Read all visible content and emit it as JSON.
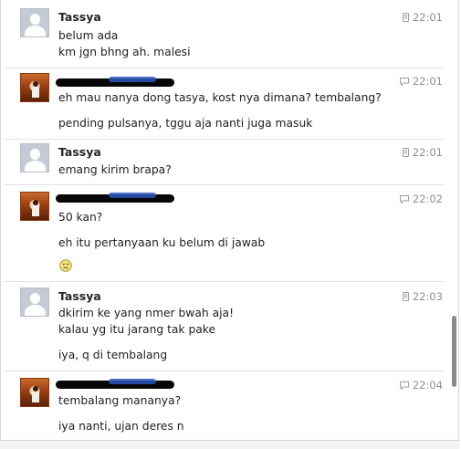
{
  "conversation": {
    "entries": [
      {
        "sender": "Tassya",
        "avatar": "default-avatar",
        "time": "22:01",
        "time_icon": "mobile-icon",
        "lines": [
          "belum ada",
          "km jgn bhng ah. malesi"
        ]
      },
      {
        "sender": "",
        "sender_redacted": true,
        "avatar": "photo-avatar",
        "time": "22:01",
        "time_icon": "chat-bubble-icon",
        "lines": [
          "eh mau nanya dong tasya, kost nya dimana? tembalang?",
          "pending pulsanya, tggu aja nanti juga masuk"
        ]
      },
      {
        "sender": "Tassya",
        "avatar": "default-avatar",
        "time": "22:01",
        "time_icon": "mobile-icon",
        "lines": [
          "emang kirim brapa?"
        ]
      },
      {
        "sender": "",
        "sender_redacted": true,
        "avatar": "photo-avatar",
        "time": "22:02",
        "time_icon": "chat-bubble-icon",
        "lines": [
          "50 kan?",
          "eh itu pertanyaan ku belum di jawab"
        ],
        "emoji": "frowning-face"
      },
      {
        "sender": "Tassya",
        "avatar": "default-avatar",
        "time": "22:03",
        "time_icon": "mobile-icon",
        "lines": [
          "dkirim ke yang nmer bwah aja!",
          "kalau yg itu jarang tak pake",
          "iya, q di tembalang"
        ]
      },
      {
        "sender": "",
        "sender_redacted": true,
        "avatar": "photo-avatar",
        "time": "22:04",
        "time_icon": "chat-bubble-icon",
        "lines": [
          "tembalang mananya?",
          "iya nanti, ujan deres n"
        ]
      }
    ]
  }
}
